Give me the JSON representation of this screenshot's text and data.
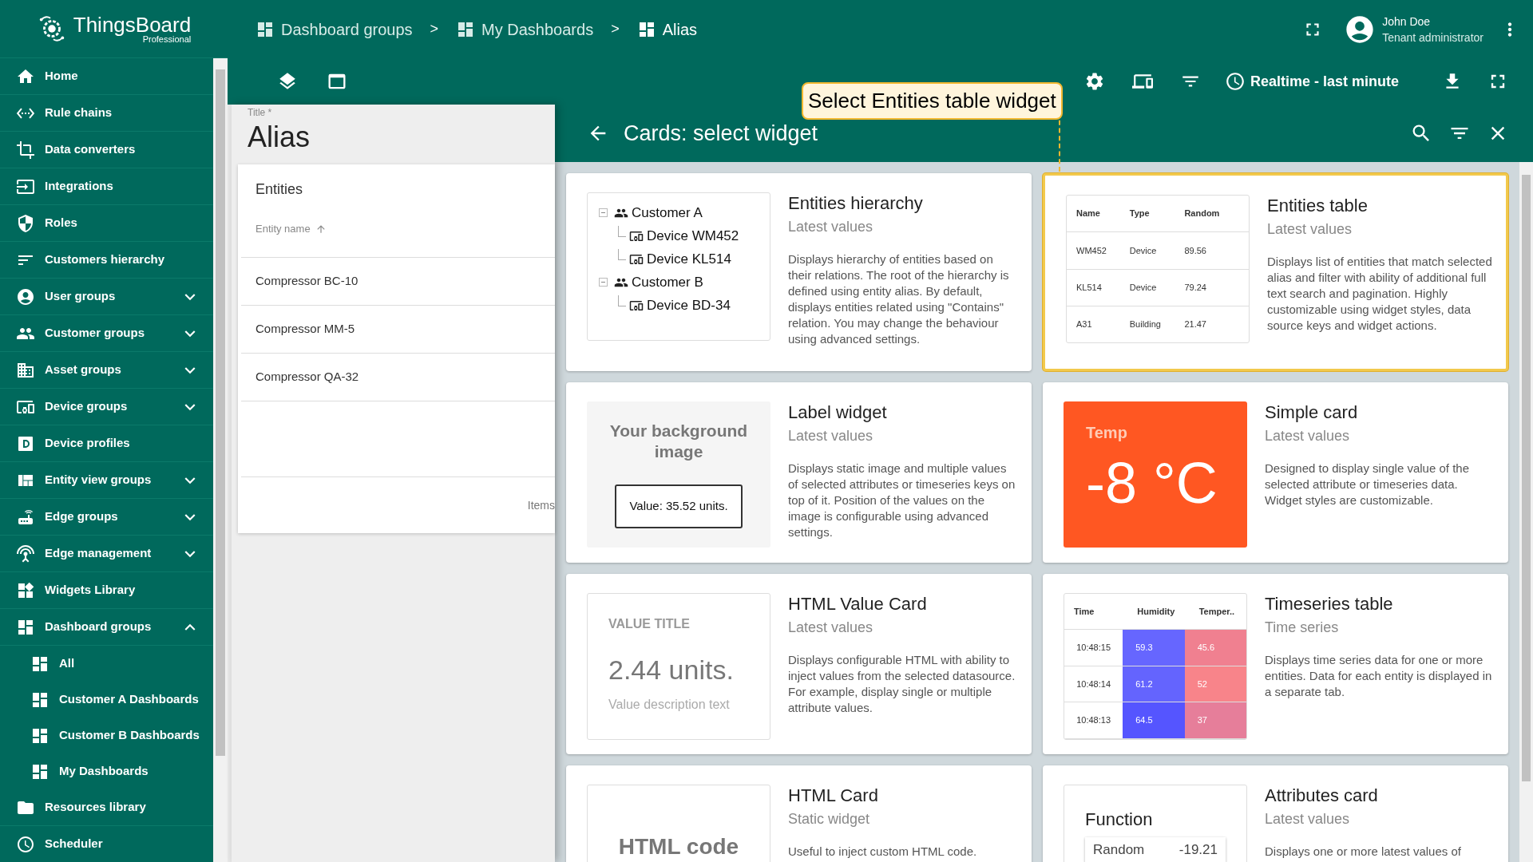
{
  "logo": {
    "name": "ThingsBoard",
    "edition": "Professional"
  },
  "sidebar": {
    "items": [
      {
        "label": "Home",
        "kind": "link"
      },
      {
        "label": "Rule chains",
        "kind": "link"
      },
      {
        "label": "Data converters",
        "kind": "link"
      },
      {
        "label": "Integrations",
        "kind": "link"
      },
      {
        "label": "Roles",
        "kind": "link"
      },
      {
        "label": "Customers hierarchy",
        "kind": "link"
      },
      {
        "label": "User groups",
        "kind": "group",
        "expanded": false
      },
      {
        "label": "Customer groups",
        "kind": "group",
        "expanded": false
      },
      {
        "label": "Asset groups",
        "kind": "group",
        "expanded": false
      },
      {
        "label": "Device groups",
        "kind": "group",
        "expanded": false
      },
      {
        "label": "Device profiles",
        "kind": "link"
      },
      {
        "label": "Entity view groups",
        "kind": "group",
        "expanded": false
      },
      {
        "label": "Edge groups",
        "kind": "group",
        "expanded": false
      },
      {
        "label": "Edge management",
        "kind": "group",
        "expanded": false
      },
      {
        "label": "Widgets Library",
        "kind": "link"
      },
      {
        "label": "Dashboard groups",
        "kind": "group",
        "expanded": true,
        "children": [
          {
            "label": "All"
          },
          {
            "label": "Customer A Dashboards"
          },
          {
            "label": "Customer B Dashboards"
          },
          {
            "label": "My Dashboards"
          }
        ]
      },
      {
        "label": "Resources library",
        "kind": "link"
      },
      {
        "label": "Scheduler",
        "kind": "link"
      }
    ]
  },
  "breadcrumbs": [
    {
      "label": "Dashboard groups",
      "separator": ">"
    },
    {
      "label": "My Dashboards",
      "separator": ">"
    },
    {
      "label": "Alias"
    }
  ],
  "user": {
    "name": "John Doe",
    "role": "Tenant administrator"
  },
  "toolbar": {
    "timewindow": "Realtime - last minute"
  },
  "editor": {
    "title_label": "Title *",
    "title": "Alias",
    "widget": {
      "title": "Entities",
      "column": "Entity name",
      "rows": [
        "Compressor BC-10",
        "Compressor MM-5",
        "Compressor QA-32"
      ],
      "footer": "Items"
    }
  },
  "tooltip": "Select Entities table widget",
  "dialog": {
    "title": "Cards: select widget",
    "cards": [
      {
        "kind": "hierarchy",
        "title": "Entities hierarchy",
        "subtitle": "Latest values",
        "selected": false,
        "description": "Displays hierarchy of entities based on their relations. The root of the hierarchy is defined using entity alias. By default, displays entities related using \"Contains\" relation. You may change the behaviour using advanced settings.",
        "tree": [
          {
            "label": "Customer A",
            "expanded": true,
            "children": [
              {
                "label": "Device WM452"
              },
              {
                "label": "Device KL514"
              }
            ]
          },
          {
            "label": "Customer B",
            "expanded": true,
            "children": [
              {
                "label": "Device BD-34"
              }
            ]
          }
        ]
      },
      {
        "kind": "table",
        "title": "Entities table",
        "subtitle": "Latest values",
        "selected": true,
        "description": "Displays list of entities that match selected alias and filter with ability of additional full text search and pagination. Highly customizable using widget styles, data source keys and widget actions.",
        "columns": [
          "Name",
          "Type",
          "Random"
        ],
        "rows": [
          [
            "WM452",
            "Device",
            "89.56"
          ],
          [
            "KL514",
            "Device",
            "79.24"
          ],
          [
            "A31",
            "Building",
            "21.47"
          ]
        ]
      },
      {
        "kind": "label",
        "title": "Label widget",
        "subtitle": "Latest values",
        "selected": false,
        "description": "Displays static image and multiple values of selected attributes or timeseries keys on top of it. Position of the values on the image is configurable using advanced settings.",
        "background": "Your background image",
        "value": "Value: 35.52 units."
      },
      {
        "kind": "simple",
        "title": "Simple card",
        "subtitle": "Latest values",
        "selected": false,
        "description": "Designed to display single value of the selected attribute or timeseries data. Widget styles are customizable.",
        "label": "Temp",
        "value": "-8 °C"
      },
      {
        "kind": "html_value",
        "title": "HTML Value Card",
        "subtitle": "Latest values",
        "selected": false,
        "description": "Displays configurable HTML with ability to inject values from the selected datasource. For example, display single or multiple attribute values.",
        "value_title": "VALUE TITLE",
        "value": "2.44 units.",
        "value_description": "Value description text"
      },
      {
        "kind": "timeseries",
        "title": "Timeseries table",
        "subtitle": "Time series",
        "selected": false,
        "description": "Displays time series data for one or more entities. Data for each entity is displayed in a separate tab.",
        "columns": [
          "Time",
          "Humidity",
          "Temper.."
        ],
        "rows": [
          [
            {
              "text": "10:48:15"
            },
            {
              "text": "59.3",
              "color": "#6666ff"
            },
            {
              "text": "45.6",
              "color": "#f08090"
            }
          ],
          [
            {
              "text": "10:48:14"
            },
            {
              "text": "61.2",
              "color": "#6464fe"
            },
            {
              "text": "52",
              "color": "#f8848a"
            }
          ],
          [
            {
              "text": "10:48:13"
            },
            {
              "text": "64.5",
              "color": "#5555ff"
            },
            {
              "text": "37",
              "color": "#e67e9a"
            }
          ]
        ]
      },
      {
        "kind": "html",
        "title": "HTML Card",
        "subtitle": "Static widget",
        "selected": false,
        "description": "Useful to inject custom HTML code.",
        "text": "HTML code"
      },
      {
        "kind": "attributes",
        "title": "Attributes card",
        "subtitle": "Latest values",
        "selected": false,
        "description": "Displays one or more latest values of",
        "heading": "Function",
        "rows": [
          {
            "key": "Random",
            "value": "-19.21"
          }
        ]
      }
    ]
  }
}
